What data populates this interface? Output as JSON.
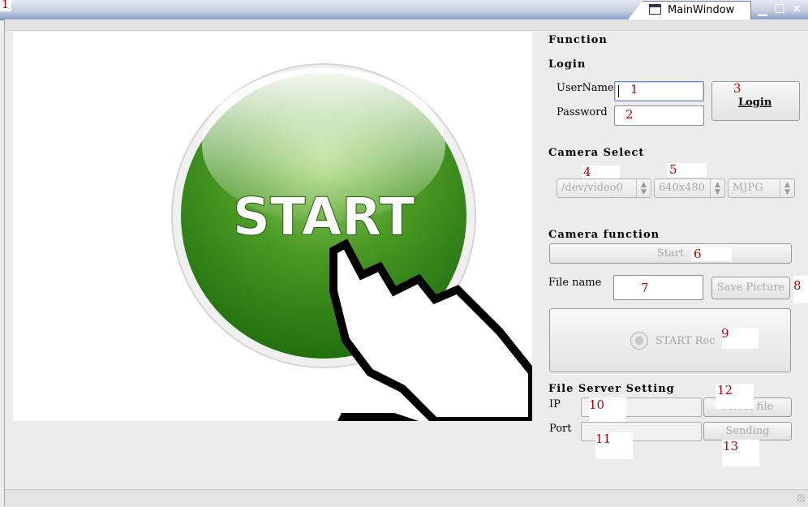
{
  "window": {
    "title": "MainWindow",
    "corner_mark": "1"
  },
  "panel": {
    "function_header": "Function",
    "login": {
      "header": "Login",
      "username_label": "UserName",
      "password_label": "Password",
      "username_mark": "1",
      "password_mark": "2",
      "button_label": "Login",
      "button_mark": "3"
    },
    "camera_select": {
      "header": "Camera Select",
      "device": "/dev/video0",
      "resolution": "640x480",
      "format": "MJPG",
      "device_mark": "4",
      "resolution_mark": "5"
    },
    "camera_function": {
      "header": "Camera function",
      "start_label": "Start",
      "start_mark": "6",
      "file_name_label": "File name",
      "file_name_mark": "7",
      "save_picture_label": "Save Picture",
      "save_picture_mark": "8",
      "start_rec_label": "START Rec",
      "start_rec_mark": "9"
    },
    "file_server": {
      "header": "File Server Setting",
      "ip_label": "IP",
      "port_label": "Port",
      "ip_mark": "10",
      "port_mark": "11",
      "select_file_label": "select file",
      "select_file_mark": "12",
      "sending_label": "Sending",
      "sending_mark": "13"
    }
  },
  "preview": {
    "start_text": "START"
  },
  "colors": {
    "accent_red": "#c00000",
    "start_green": "#3f8f1f"
  }
}
